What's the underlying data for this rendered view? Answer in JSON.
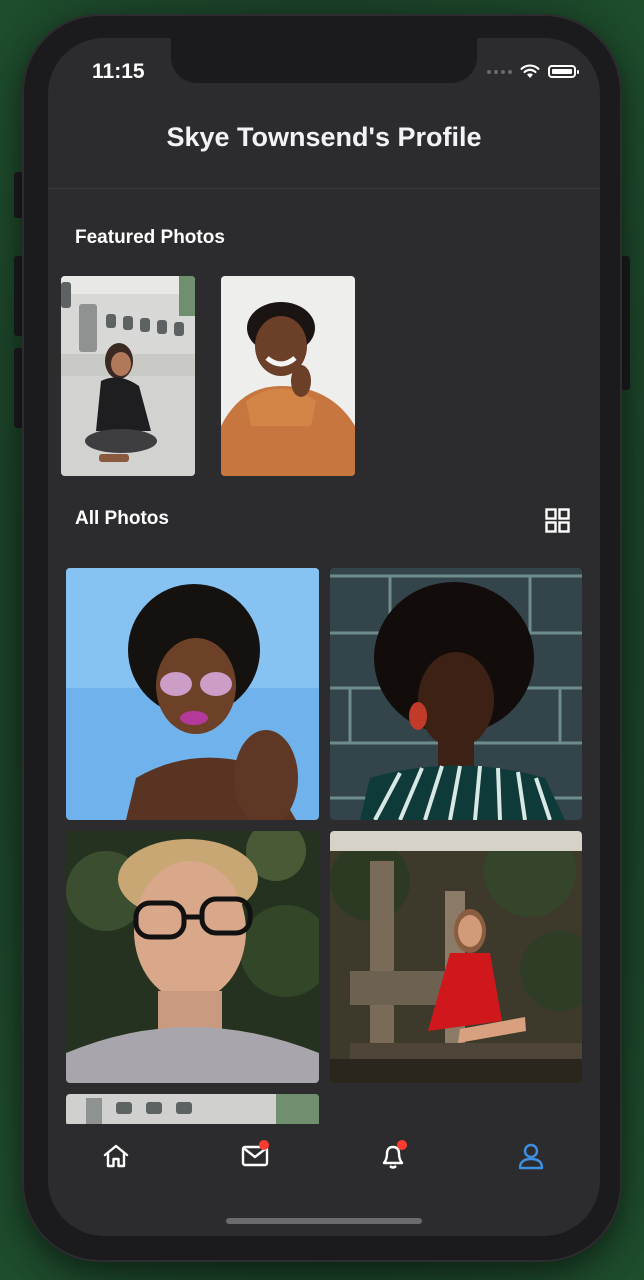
{
  "status_bar": {
    "time": "11:15"
  },
  "header": {
    "title": "Skye Townsend's Profile"
  },
  "sections": {
    "featured": "Featured Photos",
    "all": "All Photos"
  },
  "featured_photos": [
    {
      "id": "featured-1",
      "description": "woman sitting near airplane"
    },
    {
      "id": "featured-2",
      "description": "smiling person in orange sweater"
    }
  ],
  "all_photos": [
    {
      "id": "photo-1",
      "description": "woman with sunglasses, blue sky"
    },
    {
      "id": "photo-2",
      "description": "woman in striped top, brick wall"
    },
    {
      "id": "photo-3",
      "description": "man with glasses, green background"
    },
    {
      "id": "photo-4",
      "description": "woman in red dress, treehouse"
    },
    {
      "id": "photo-5",
      "description": "partially visible photo"
    }
  ],
  "tab_bar": {
    "items": [
      {
        "name": "home",
        "active": false,
        "badge": false
      },
      {
        "name": "messages",
        "active": false,
        "badge": true
      },
      {
        "name": "notifications",
        "active": false,
        "badge": true
      },
      {
        "name": "profile",
        "active": true,
        "badge": false
      }
    ],
    "active_color": "#3d8fe0",
    "inactive_color": "#ffffff",
    "badge_color": "#ff3b30"
  }
}
